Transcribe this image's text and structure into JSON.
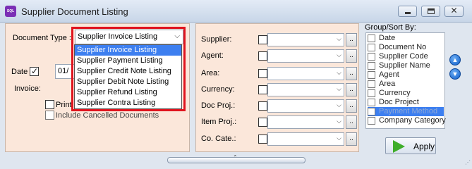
{
  "window": {
    "icon_text": "SQL",
    "title": "Supplier Document Listing"
  },
  "left_panel": {
    "document_type_label": "Document Type :",
    "document_type_value": "Supplier Invoice Listing",
    "date_label": "Date",
    "date_value": "01/",
    "invoice_label": "Invoice:",
    "print_label": "Print",
    "include_cancelled_label": "Include Cancelled Documents",
    "dropdown_options": [
      "Supplier Invoice Listing",
      "Supplier Payment Listing",
      "Supplier Credit Note Listing",
      "Supplier Debit Note Listing",
      "Supplier Refund Listing",
      "Supplier Contra Listing"
    ],
    "selected_option_index": 0
  },
  "filters": [
    {
      "label": "Supplier:",
      "button": ".."
    },
    {
      "label": "Agent:",
      "button": ".."
    },
    {
      "label": "Area:",
      "button": ".."
    },
    {
      "label": "Currency:",
      "button": ".."
    },
    {
      "label": "Doc Proj.:",
      "button": ".."
    },
    {
      "label": "Item Proj.:",
      "button": ".."
    },
    {
      "label": "Co. Cate.:",
      "button": ".."
    }
  ],
  "group_sort": {
    "title": "Group/Sort By:",
    "items": [
      {
        "label": "Date",
        "highlighted": false
      },
      {
        "label": "Document No",
        "highlighted": false
      },
      {
        "label": "Supplier Code",
        "highlighted": false
      },
      {
        "label": "Supplier Name",
        "highlighted": false
      },
      {
        "label": "Agent",
        "highlighted": false
      },
      {
        "label": "Area",
        "highlighted": false
      },
      {
        "label": "Currency",
        "highlighted": false
      },
      {
        "label": "Doc Project",
        "highlighted": false
      },
      {
        "label": "Payment Method",
        "highlighted": true
      },
      {
        "label": "Company Category",
        "highlighted": false
      }
    ],
    "move_up_icon": "arrow-up-icon",
    "move_down_icon": "arrow-down-icon"
  },
  "apply_button": {
    "label": "Apply",
    "icon": "play-icon"
  },
  "splitter_glyph": "⌃",
  "colors": {
    "panel_bg": "#fbe7da",
    "window_bg": "#dfe6ef",
    "selection": "#3d7ff0",
    "highlight_frame": "#e0141e",
    "apply_icon": "#3fae2a"
  }
}
